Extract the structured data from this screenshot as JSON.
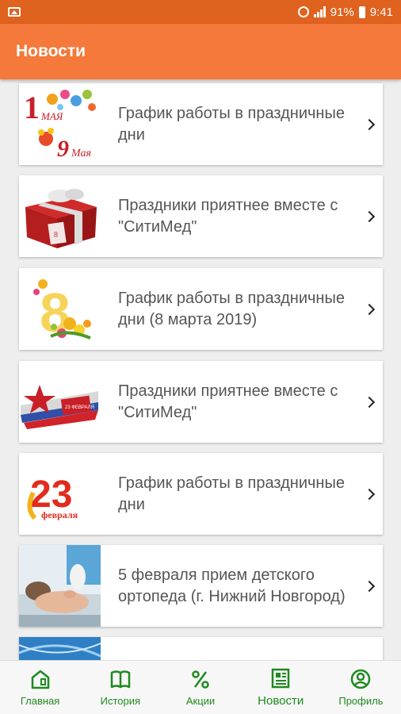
{
  "statusbar": {
    "battery": "91%",
    "time": "9:41"
  },
  "appbar": {
    "title": "Новости"
  },
  "news": [
    {
      "title": "График работы в праздничные дни",
      "image": "may-holidays-image"
    },
    {
      "title": "Праздники приятнее вместе с \"СитиМед\"",
      "image": "gift-box-image"
    },
    {
      "title": "График работы в праздничные дни (8 марта 2019)",
      "image": "march-8-image"
    },
    {
      "title": "Праздники приятнее вместе с \"СитиМед\"",
      "image": "feb-23-star-image"
    },
    {
      "title": "График работы в праздничные дни",
      "image": "feb-23-image"
    },
    {
      "title": "5 февраля прием детского ортопеда (г. Нижний Новгород)",
      "image": "orthopedist-photo"
    },
    {
      "title": "",
      "image": "dna-image"
    }
  ],
  "nav": [
    {
      "label": "Главная",
      "icon": "home-icon"
    },
    {
      "label": "История",
      "icon": "book-icon"
    },
    {
      "label": "Акции",
      "icon": "percent-icon"
    },
    {
      "label": "Новости",
      "icon": "newspaper-icon",
      "active": true
    },
    {
      "label": "Профиль",
      "icon": "profile-icon"
    }
  ],
  "colors": {
    "statusbar": "#e0621f",
    "appbar": "#f4793b",
    "nav_accent": "#1e8a1e",
    "background": "#eeeeee"
  }
}
